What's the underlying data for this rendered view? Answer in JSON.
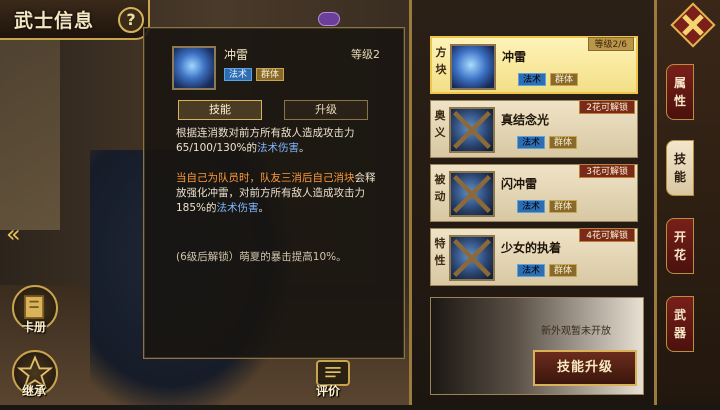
{
  "header": {
    "title": "武士信息",
    "help_label": "?"
  },
  "skill_detail": {
    "name": "冲雷",
    "level": "等级2",
    "tags": [
      "法术",
      "群体"
    ],
    "tabs": [
      "技能",
      "升级"
    ],
    "desc1_a": "根据连消数对前方所有敌人造成攻击力65/100/130%的",
    "desc1_b": "法术伤害",
    "desc1_c": "。",
    "desc2_a": "当自己为队员时，队友三消后自己消块",
    "desc2_b": "会释放强化冲雷，对前方所有敌人造成攻击力185%的",
    "desc2_c": "法术伤害",
    "desc2_d": "。",
    "desc3": "(6级后解锁）萌夏的暴击提高10%。"
  },
  "skill_list": [
    {
      "type": "方块",
      "name": "冲雷",
      "badge": "等级2/6",
      "tags": [
        "法术",
        "群体"
      ]
    },
    {
      "type": "奥义",
      "name": "真结念光",
      "badge": "2花可解锁",
      "tags": [
        "法术",
        "群体"
      ]
    },
    {
      "type": "被动",
      "name": "闪冲雷",
      "badge": "3花可解锁",
      "tags": [
        "法术",
        "群体"
      ]
    },
    {
      "type": "特性",
      "name": "少女的执着",
      "badge": "4花可解锁",
      "tags": [
        "法术",
        "群体"
      ]
    }
  ],
  "outfit": {
    "text": "新外观暂未开放",
    "upgrade_label": "技能升级"
  },
  "side_tabs": [
    "属性",
    "技能",
    "开花",
    "武器"
  ],
  "bottom": {
    "album_label": "卡册",
    "inherit_label": "继承",
    "evaluate_label": "评价"
  },
  "colors": {
    "gold": "#c9a44f",
    "accent_blue": "#7fb6ff",
    "accent_orange": "#ff9a3a",
    "tab_red": "#7a1f1a"
  }
}
